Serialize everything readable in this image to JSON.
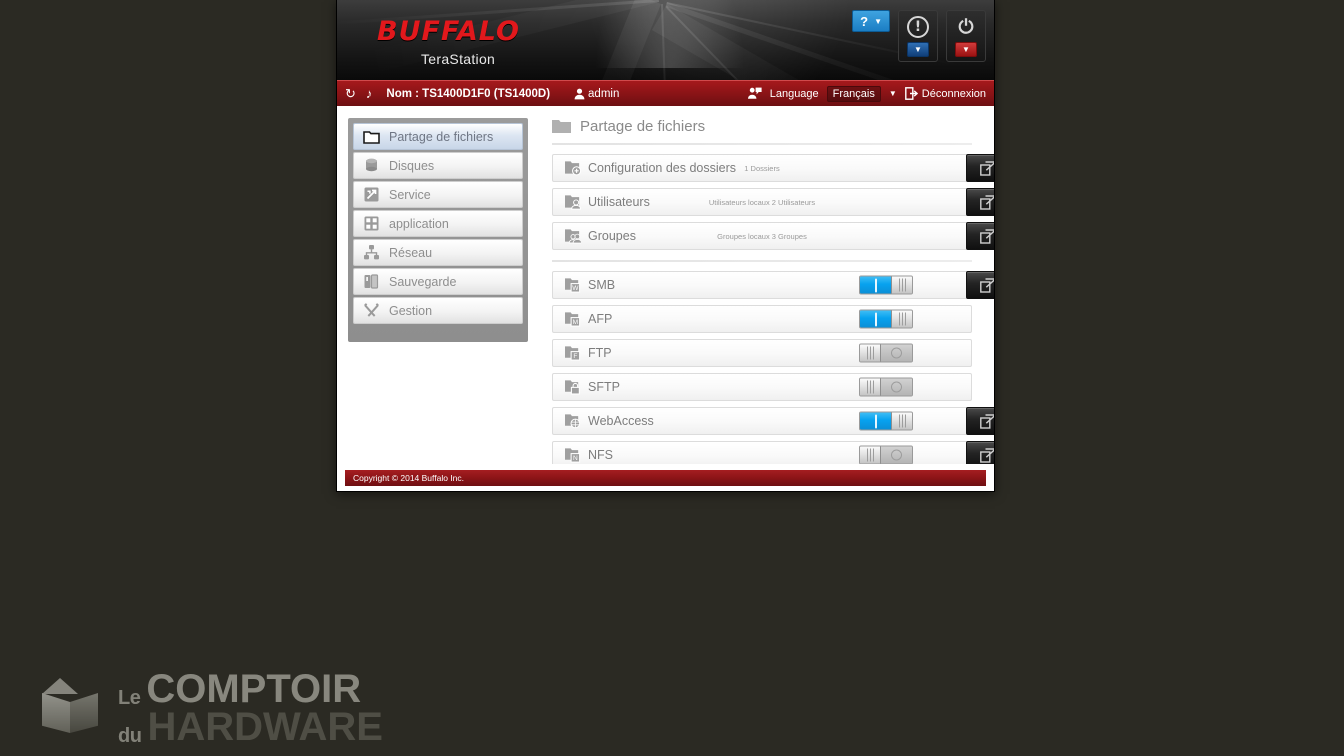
{
  "header": {
    "brand": "BUFFALO",
    "product": "TeraStation",
    "help_label": "?",
    "help_caret": "▼",
    "alert_icon": "!",
    "alert_caret": "▼",
    "power_icon": "⏻",
    "power_caret": "▼"
  },
  "toolbar": {
    "refresh_icon": "↻",
    "sound_icon": "♪",
    "device_name": "Nom : TS1400D1F0 (TS1400D)",
    "user_icon": "user-icon",
    "user_name": "admin",
    "language_icon": "language-icon",
    "language_label": "Language",
    "language_value": "Français",
    "language_caret": "▼",
    "logout_icon": "logout-icon",
    "logout_label": "Déconnexion"
  },
  "sidebar": {
    "items": [
      {
        "label": "Partage de fichiers",
        "icon": "folder-icon",
        "active": true
      },
      {
        "label": "Disques",
        "icon": "disk-icon",
        "active": false
      },
      {
        "label": "Service",
        "icon": "service-icon",
        "active": false
      },
      {
        "label": "application",
        "icon": "application-icon",
        "active": false
      },
      {
        "label": "Réseau",
        "icon": "network-icon",
        "active": false
      },
      {
        "label": "Sauvegarde",
        "icon": "backup-icon",
        "active": false
      },
      {
        "label": "Gestion",
        "icon": "tools-icon",
        "active": false
      }
    ]
  },
  "main": {
    "page_title": "Partage de fichiers",
    "page_title_icon": "folder-icon",
    "top_rows": [
      {
        "label": "Configuration des dossiers",
        "icon": "folder-add-icon",
        "meta": "1 Dossiers",
        "launch": true
      },
      {
        "label": "Utilisateurs",
        "icon": "folder-user-icon",
        "meta": "Utilisateurs locaux 2 Utilisateurs",
        "launch": true
      },
      {
        "label": "Groupes",
        "icon": "folder-group-icon",
        "meta": "Groupes locaux 3 Groupes",
        "launch": true
      }
    ],
    "service_rows": [
      {
        "label": "SMB",
        "icon": "folder-w-icon",
        "enabled": true,
        "launch": true
      },
      {
        "label": "AFP",
        "icon": "folder-m-icon",
        "enabled": true,
        "launch": false
      },
      {
        "label": "FTP",
        "icon": "folder-f-icon",
        "enabled": false,
        "launch": false
      },
      {
        "label": "SFTP",
        "icon": "folder-lock-icon",
        "enabled": false,
        "launch": false
      },
      {
        "label": "WebAccess",
        "icon": "folder-web-icon",
        "enabled": true,
        "launch": true
      },
      {
        "label": "NFS",
        "icon": "folder-n-icon",
        "enabled": false,
        "launch": true
      }
    ]
  },
  "footer": {
    "copyright": "Copyright © 2014 Buffalo Inc."
  },
  "watermark": {
    "line1_small": "Le",
    "line1_big": "COMPTOIR",
    "line2_small": "du",
    "line2_big": "HARDWARE"
  },
  "colors": {
    "brand_red": "#e2181c",
    "toolbar_red": "#8d1417",
    "toggle_on": "#07a2ef",
    "toggle_off": "#c2c2c2",
    "active_nav": "#c8d6e8"
  }
}
